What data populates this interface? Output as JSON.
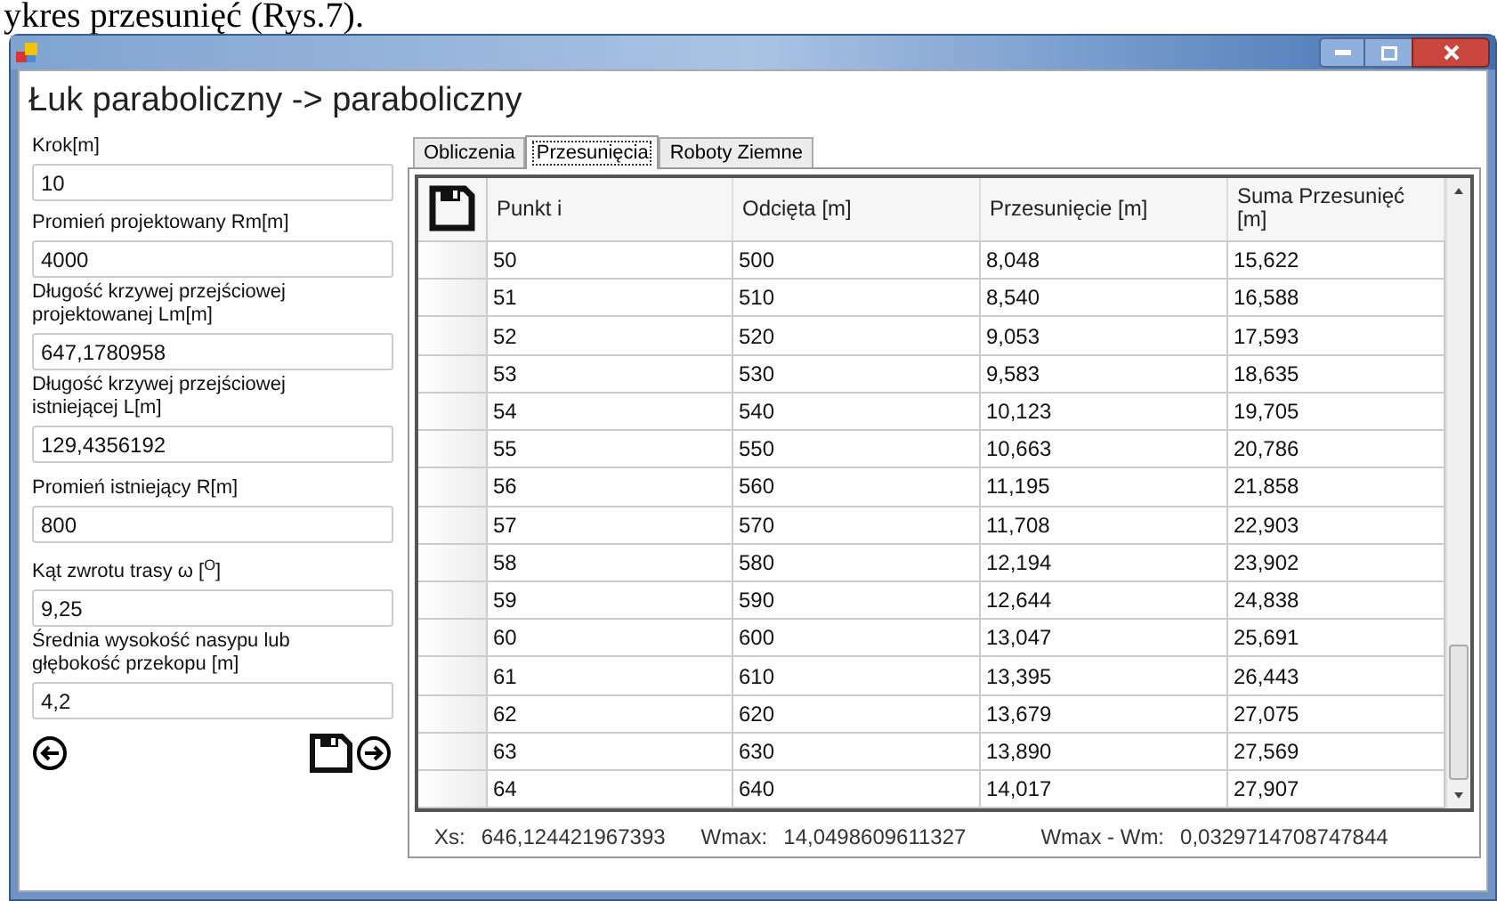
{
  "document_caption": "ykres przesunięć (Rys.7).",
  "window": {
    "title": "Łuk paraboliczny -> paraboliczny"
  },
  "fields": [
    {
      "label": "Krok[m]",
      "value": "10"
    },
    {
      "label": "Promień projektowany Rm[m]",
      "value": "4000"
    },
    {
      "label": "Długość krzywej przejściowej projektowanej Lm[m]",
      "value": "647,1780958"
    },
    {
      "label": "Długość krzywej przejściowej istniejącej L[m]",
      "value": "129,4356192"
    },
    {
      "label": "Promień istniejący R[m]",
      "value": "800"
    },
    {
      "label": "Kąt zwrotu trasy ω  [$^{O}$]",
      "value": "9,25"
    },
    {
      "label": "Średnia wysokość nasypu lub głębokość przekopu [m]",
      "value": "4,2"
    }
  ],
  "tabs": [
    {
      "label": "Obliczenia",
      "selected": false
    },
    {
      "label": "Przesunięcia",
      "selected": true
    },
    {
      "label": "Roboty Ziemne",
      "selected": false
    }
  ],
  "table": {
    "columns": [
      "Punkt i",
      "Odcięta [m]",
      "Przesunięcie [m]",
      "Suma Przesunięć [m]"
    ],
    "rows": [
      [
        "50",
        "500",
        "8,048",
        "15,622"
      ],
      [
        "51",
        "510",
        "8,540",
        "16,588"
      ],
      [
        "52",
        "520",
        "9,053",
        "17,593"
      ],
      [
        "53",
        "530",
        "9,583",
        "18,635"
      ],
      [
        "54",
        "540",
        "10,123",
        "19,705"
      ],
      [
        "55",
        "550",
        "10,663",
        "20,786"
      ],
      [
        "56",
        "560",
        "11,195",
        "21,858"
      ],
      [
        "57",
        "570",
        "11,708",
        "22,903"
      ],
      [
        "58",
        "580",
        "12,194",
        "23,902"
      ],
      [
        "59",
        "590",
        "12,644",
        "24,838"
      ],
      [
        "60",
        "600",
        "13,047",
        "25,691"
      ],
      [
        "61",
        "610",
        "13,395",
        "26,443"
      ],
      [
        "62",
        "620",
        "13,679",
        "27,075"
      ],
      [
        "63",
        "630",
        "13,890",
        "27,569"
      ],
      [
        "64",
        "640",
        "14,017",
        "27,907"
      ]
    ]
  },
  "results": [
    {
      "label": "Xs:",
      "value": "646,124421967393"
    },
    {
      "label": "Wmax:",
      "value": "14,0498609611327"
    },
    {
      "label": "Wmax - Wm:",
      "value": "0,0329714708747844"
    }
  ]
}
